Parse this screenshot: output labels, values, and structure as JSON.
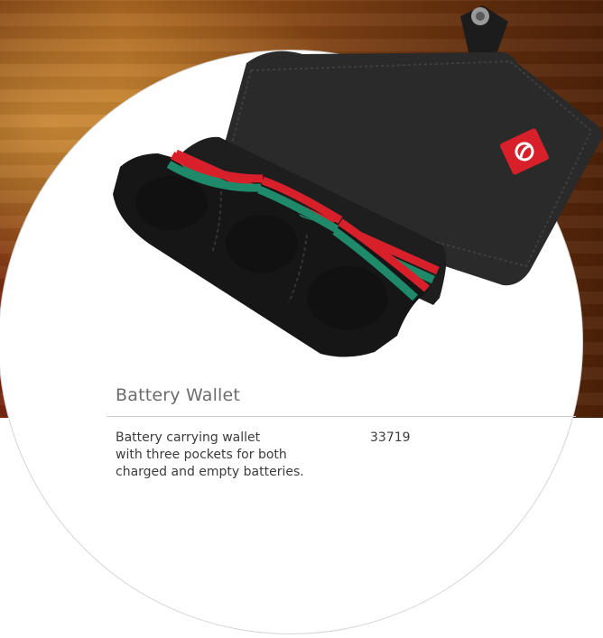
{
  "product": {
    "title": "Battery Wallet",
    "description_lines": [
      "Battery carrying wallet",
      "with three pockets for both",
      "charged and empty batteries."
    ],
    "article_number": "33719"
  },
  "colors": {
    "wallet": "#1f1f1f",
    "stripe_red": "#d8202a",
    "stripe_green": "#1e8a6a",
    "text": "#3c3c3c",
    "title": "#6c6c6c"
  },
  "icons": {
    "brand_tag": "brand-logo-icon"
  }
}
